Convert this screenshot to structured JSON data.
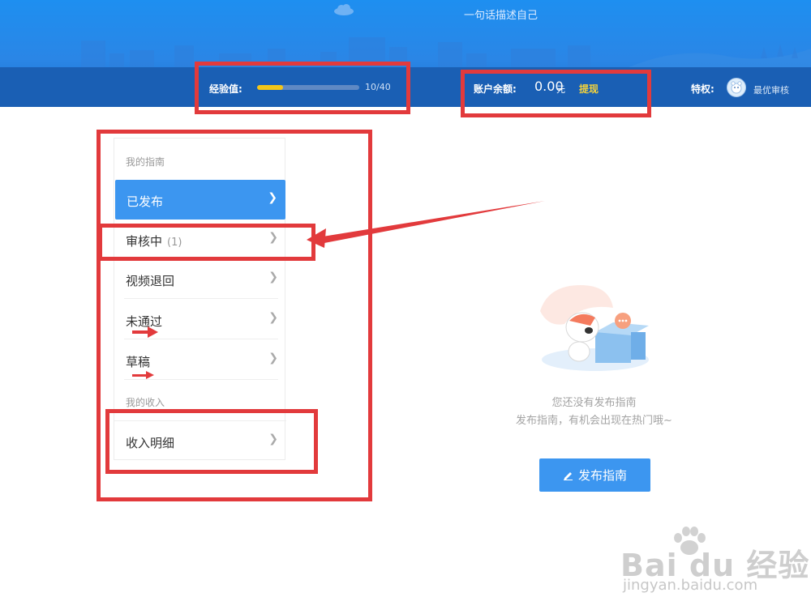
{
  "header": {
    "tagline": "一句话描述自己",
    "exp_label": "经验值:",
    "exp_count": "10/40",
    "exp_progress": 0.25,
    "balance_label": "账户余额:",
    "balance_amount": "0.00",
    "balance_unit": "元",
    "withdraw_label": "提现",
    "privilege_label": "特权:",
    "privilege_name": "最优审核"
  },
  "sidebar": {
    "section_guides": "我的指南",
    "items": [
      {
        "label": "已发布",
        "count": ""
      },
      {
        "label": "审核中",
        "count": "(1)"
      },
      {
        "label": "视频退回",
        "count": ""
      },
      {
        "label": "未通过",
        "count": ""
      },
      {
        "label": "草稿",
        "count": ""
      }
    ],
    "section_income": "我的收入",
    "income_items": [
      {
        "label": "收入明细"
      }
    ]
  },
  "main": {
    "empty_line1": "您还没有发布指南",
    "empty_line2": "发布指南，有机会出现在热门哦~",
    "publish_label": "发布指南"
  },
  "watermark": {
    "brand": "Bai du 经验",
    "url": "jingyan.baidu.com"
  },
  "colors": {
    "banner": "#1e8ff0",
    "statbar": "#1a5fb4",
    "accent": "#3c96f0",
    "progress": "#f3c517",
    "annotation": "#e23a3c"
  }
}
